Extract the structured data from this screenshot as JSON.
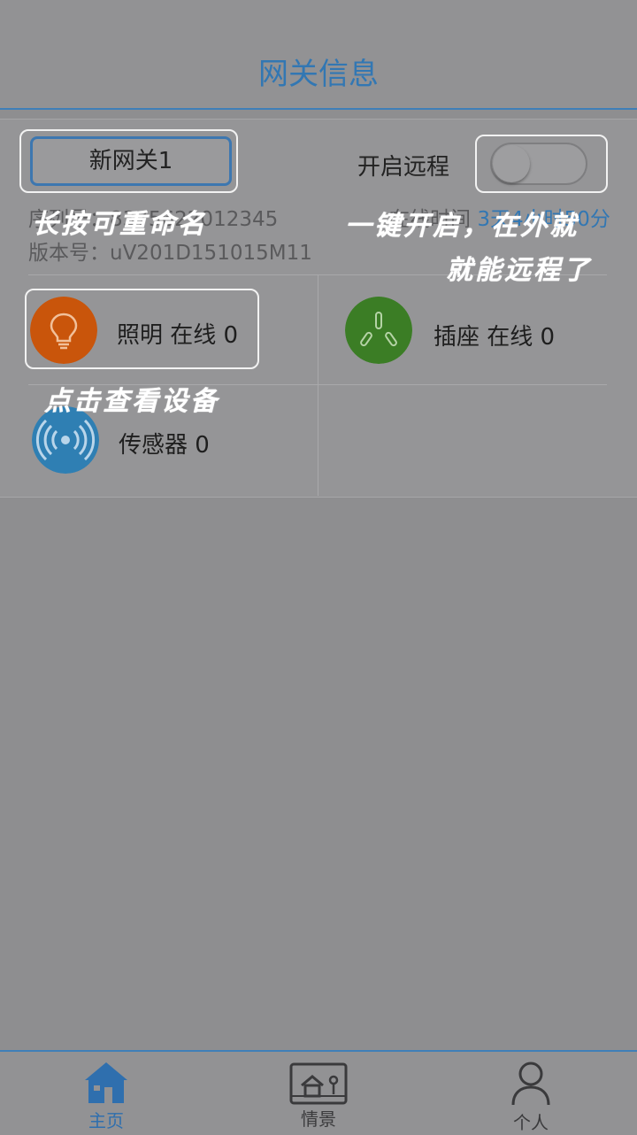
{
  "header": {
    "title": "网关信息"
  },
  "gateway": {
    "name": "新网关1",
    "remote_label": "开启远程",
    "remote_on": false,
    "serial_label": "序列号：",
    "serial_value": "8375622012345",
    "online_label": "在线时间",
    "online_value": "3天4小时50分",
    "version": "版本号：uV201D151015M11"
  },
  "devices": [
    {
      "label": "照明 在线 0",
      "icon": "bulb-icon",
      "color": "#c9550b"
    },
    {
      "label": "插座 在线 0",
      "icon": "socket-icon",
      "color": "#3b7d25"
    },
    {
      "label": "传感器 0",
      "icon": "sensor-icon",
      "color": "#2f7fb3"
    }
  ],
  "hints": {
    "rename": "长按可重命名",
    "remote_line1": "一键开启，在外就",
    "remote_line2": "就能远程了",
    "view_devices": "点击查看设备"
  },
  "tabbar": [
    {
      "label": "主页",
      "icon": "home-icon",
      "active": true
    },
    {
      "label": "情景",
      "icon": "scene-icon",
      "active": false
    },
    {
      "label": "个人",
      "icon": "person-icon",
      "active": false
    }
  ]
}
